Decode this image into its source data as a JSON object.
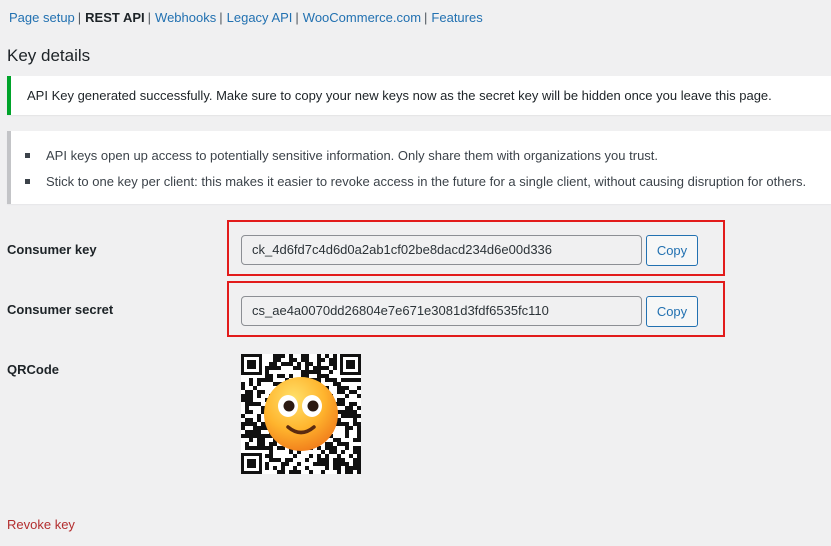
{
  "subnav": {
    "items": [
      {
        "label": "Page setup",
        "current": false
      },
      {
        "label": "REST API",
        "current": true
      },
      {
        "label": "Webhooks",
        "current": false
      },
      {
        "label": "Legacy API",
        "current": false
      },
      {
        "label": "WooCommerce.com",
        "current": false
      },
      {
        "label": "Features",
        "current": false
      }
    ],
    "separator": "|"
  },
  "page": {
    "title": "Key details"
  },
  "notice_success": {
    "text": "API Key generated successfully. Make sure to copy your new keys now as the secret key will be hidden once you leave this page.",
    "accent_color": "#00a32a"
  },
  "notice_info": {
    "items": [
      "API keys open up access to potentially sensitive information. Only share them with organizations you trust.",
      "Stick to one key per client: this makes it easier to revoke access in the future for a single client, without causing disruption for others."
    ]
  },
  "consumer_key": {
    "label": "Consumer key",
    "value": "ck_4d6fd7c4d6d0a2ab1cf02be8dacd234d6e00d336",
    "copy_label": "Copy"
  },
  "consumer_secret": {
    "label": "Consumer secret",
    "value": "cs_ae4a0070dd26804e7e671e3081d3fdf6535fc110",
    "copy_label": "Copy"
  },
  "qrcode": {
    "label": "QRCode",
    "overlay_icon": "smiling-face-emoji-icon"
  },
  "revoke": {
    "label": "Revoke key",
    "color": "#b32d2e"
  },
  "colors": {
    "link": "#2271b1",
    "highlight_box": "#e21b1b",
    "background": "#f0f0f1"
  }
}
